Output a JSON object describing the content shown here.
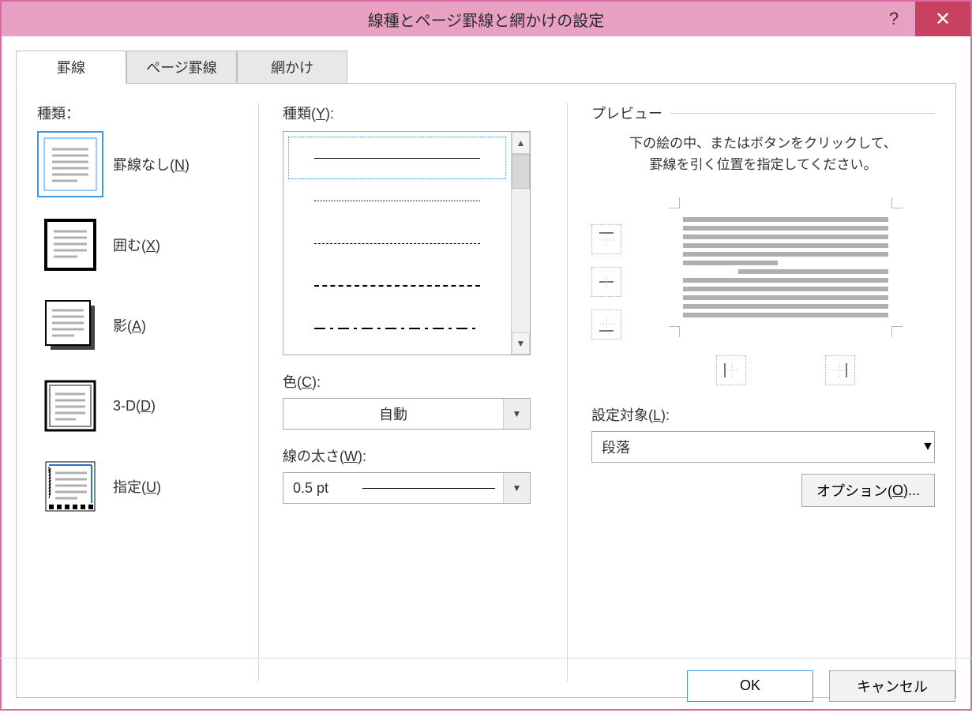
{
  "titlebar": {
    "title": "線種とページ罫線と網かけの設定",
    "help": "?",
    "close": "✕"
  },
  "tabs": {
    "borders": "罫線",
    "page_borders": "ページ罫線",
    "shading": "網かけ"
  },
  "left": {
    "heading": "種類：",
    "items": [
      {
        "label": "罫線なし(",
        "accel": "N",
        "suffix": ")"
      },
      {
        "label": "囲む(",
        "accel": "X",
        "suffix": ")"
      },
      {
        "label": "影(",
        "accel": "A",
        "suffix": ")"
      },
      {
        "label": "3-D(",
        "accel": "D",
        "suffix": ")"
      },
      {
        "label": "指定(",
        "accel": "U",
        "suffix": ")"
      }
    ]
  },
  "mid": {
    "style_label": "種類(",
    "style_accel": "Y",
    "style_suffix": "):",
    "color_label": "色(",
    "color_accel": "C",
    "color_suffix": "):",
    "color_value": "自動",
    "width_label": "線の太さ(",
    "width_accel": "W",
    "width_suffix": "):",
    "width_value": "0.5 pt"
  },
  "right": {
    "preview_title": "プレビュー",
    "hint_l1": "下の絵の中、またはボタンをクリックして、",
    "hint_l2": "罫線を引く位置を指定してください。",
    "apply_label": "設定対象(",
    "apply_accel": "L",
    "apply_suffix": "):",
    "apply_value": "段落",
    "options_label": "オプション(",
    "options_accel": "O",
    "options_suffix": ")..."
  },
  "footer": {
    "ok": "OK",
    "cancel": "キャンセル"
  }
}
